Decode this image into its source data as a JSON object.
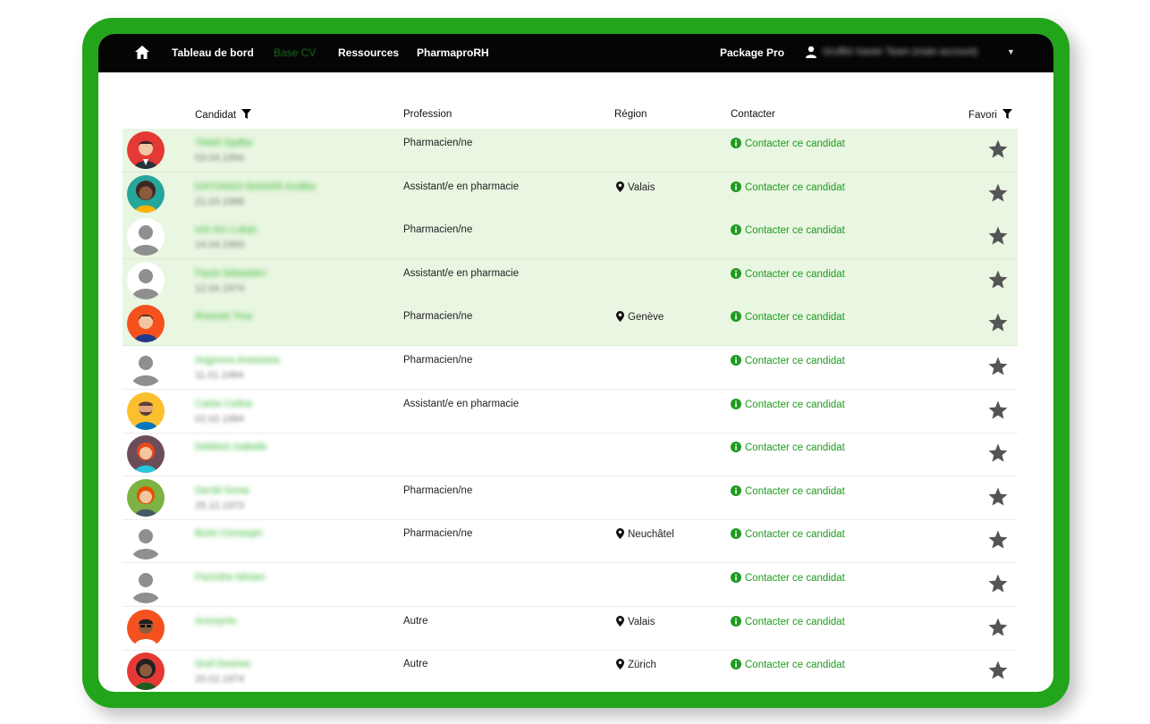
{
  "nav": {
    "links": [
      "Tableau de bord",
      "Base CV",
      "Ressources",
      "PharmaproRH"
    ],
    "package": "Package Pro",
    "user": "Gruffot Xavier Team (main account)"
  },
  "table": {
    "headers": {
      "candidate": "Candidat",
      "profession": "Profession",
      "region": "Région",
      "contact": "Contacter",
      "favorite": "Favori"
    },
    "contact_label": "Contacter ce candidat",
    "rows": [
      {
        "name": "TAMS Djaffar",
        "date": "03.04.1994",
        "profession": "Pharmacien/ne",
        "region": "",
        "avatar": "man-suit-red"
      },
      {
        "name": "KAYONGO BANARI Andika",
        "date": "21.03.1988",
        "profession": "Assistant/e en pharmacie",
        "region": "Valais",
        "avatar": "woman-teal"
      },
      {
        "name": "von Arx Lukas",
        "date": "14.04.1993",
        "profession": "Pharmacien/ne",
        "region": "",
        "avatar": "default"
      },
      {
        "name": "Faust Sébastien",
        "date": "12.04.1974",
        "profession": "Assistant/e en pharmacie",
        "region": "",
        "avatar": "default"
      },
      {
        "name": "Rossolo Tina",
        "date": "",
        "profession": "Pharmacien/ne",
        "region": "Genève",
        "avatar": "man-orange"
      },
      {
        "name": "Argyrova Anastasia",
        "date": "11.01.1984",
        "profession": "Pharmacien/ne",
        "region": "",
        "avatar": "default"
      },
      {
        "name": "Carbo Celine",
        "date": "02.02.1984",
        "profession": "Assistant/e en pharmacie",
        "region": "",
        "avatar": "man-beard-yellow"
      },
      {
        "name": "Debbick Isabelle",
        "date": "",
        "profession": "",
        "region": "",
        "avatar": "woman-purple"
      },
      {
        "name": "Gerdil Sonia",
        "date": "25.12.1973",
        "profession": "Pharmacien/ne",
        "region": "",
        "avatar": "woman-green"
      },
      {
        "name": "Bürki Christoph",
        "date": "",
        "profession": "Pharmacien/ne",
        "region": "Neuchâtel",
        "avatar": "default"
      },
      {
        "name": "Pacinthe Miriam",
        "date": "",
        "profession": "",
        "region": "",
        "avatar": "default"
      },
      {
        "name": "Anonyme",
        "date": "",
        "profession": "Autre",
        "region": "Valais",
        "avatar": "man-glasses-orange"
      },
      {
        "name": "Graf Desiree",
        "date": "20.02.1974",
        "profession": "Autre",
        "region": "Zürich",
        "avatar": "woman-dark-red"
      }
    ]
  },
  "colors": {
    "frame": "#22a51a",
    "navbar": "#050505",
    "highlight": "#e9f6e2",
    "contact": "#1f9a1f",
    "star": "#555555"
  },
  "icons": {
    "home": "home-icon",
    "filter": "filter-icon",
    "pin": "map-pin-icon",
    "info": "info-icon",
    "star": "star-icon",
    "user": "user-icon"
  }
}
